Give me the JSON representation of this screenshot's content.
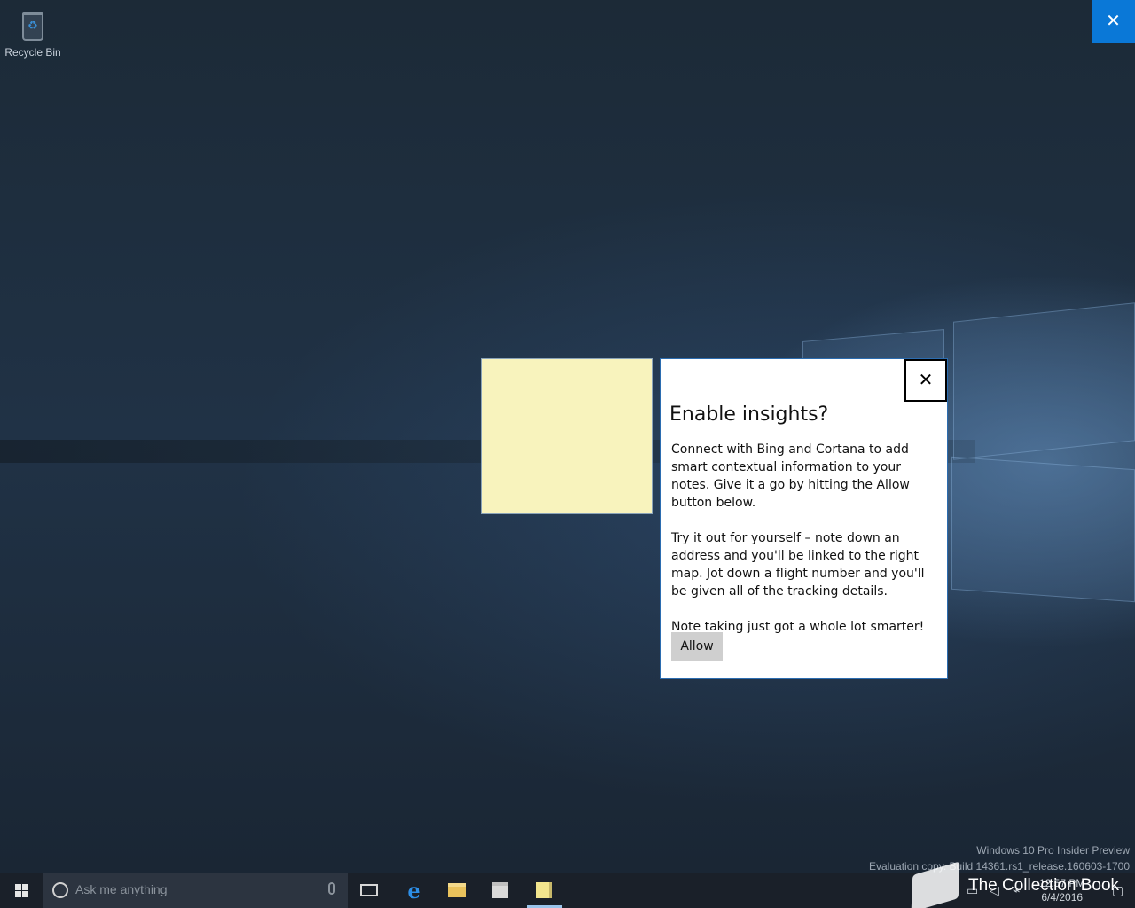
{
  "desktop": {
    "recycle_bin_label": "Recycle Bin",
    "watermark_line1": "Windows 10 Pro Insider Preview",
    "watermark_line2": "Evaluation copy. Build 14361.rs1_release.160603-1700"
  },
  "top_close": {
    "icon": "close-icon",
    "glyph": "✕"
  },
  "dialog": {
    "close_glyph": "✕",
    "title": "Enable insights?",
    "paragraph1": "Connect with Bing and Cortana to add smart contextual information to your notes. Give it a go by hitting the Allow button below.",
    "paragraph2": "Try it out for yourself – note down an address and you'll be linked to the right map. Jot down a flight number and you'll be given all of the tracking details.",
    "paragraph3": "Note taking just got a whole lot smarter!",
    "allow_label": "Allow"
  },
  "taskbar": {
    "search_placeholder": "Ask me anything",
    "edge_glyph": "e",
    "tray_time": "12:57 PM",
    "tray_date": "6/4/2016"
  },
  "overlay": {
    "collection_text": "The Collection Book"
  },
  "colors": {
    "accent": "#0a78d7",
    "sticky_yellow": "#f8f3bd",
    "taskbar": "#1a2029"
  }
}
